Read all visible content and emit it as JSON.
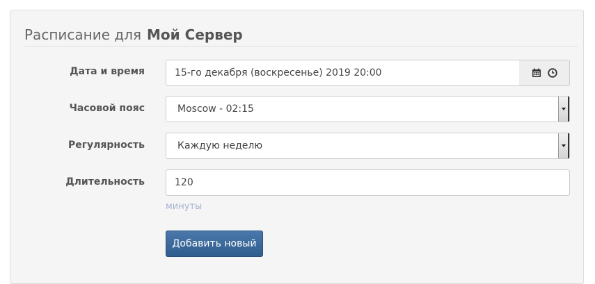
{
  "header": {
    "prefix": "Расписание для",
    "server_name": "Мой Сервер"
  },
  "form": {
    "datetime": {
      "label": "Дата и время",
      "value": "15-го декабря (воскресенье) 2019 20:00",
      "icons": [
        "calendar-icon",
        "clock-icon"
      ]
    },
    "timezone": {
      "label": "Часовой пояс",
      "value": "Moscow - 02:15"
    },
    "recurrence": {
      "label": "Регулярность",
      "value": "Каждую неделю"
    },
    "duration": {
      "label": "Длительность",
      "value": "120",
      "help": "минуты"
    },
    "submit_label": "Добавить новый"
  },
  "colors": {
    "primary_button": "#3a6898",
    "help_text": "#a6b3cf",
    "panel_bg": "#f5f5f5"
  }
}
